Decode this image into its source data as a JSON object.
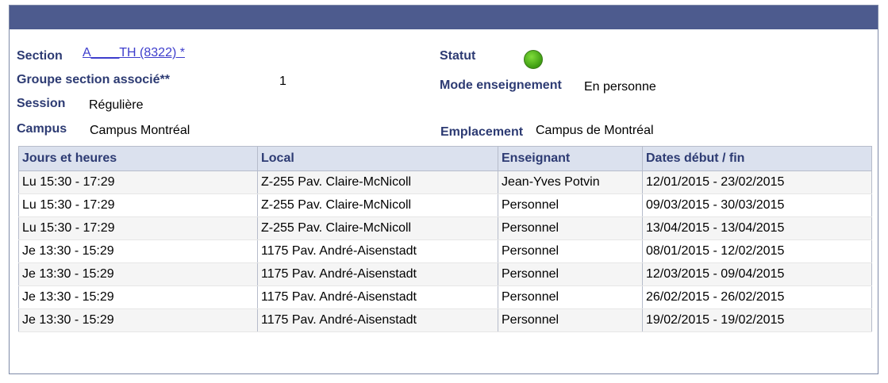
{
  "section": {
    "label": "Section",
    "value": "A____TH (8322) *"
  },
  "statut": {
    "label": "Statut",
    "indicator": "green-circle-icon",
    "color": "#52b81e"
  },
  "groupe": {
    "label": "Groupe section associé**",
    "value": "1"
  },
  "mode": {
    "label": "Mode enseignement",
    "value": "En personne"
  },
  "session": {
    "label": "Session",
    "value": "Régulière"
  },
  "campus": {
    "label": "Campus",
    "value": "Campus Montréal"
  },
  "emplacement": {
    "label": "Emplacement",
    "value": "Campus de Montréal"
  },
  "table": {
    "headers": [
      "Jours et heures",
      "Local",
      "Enseignant",
      "Dates début / fin"
    ],
    "rows": [
      [
        "Lu 15:30 - 17:29",
        "Z-255 Pav. Claire-McNicoll",
        "Jean-Yves Potvin",
        "12/01/2015 - 23/02/2015"
      ],
      [
        "Lu 15:30 - 17:29",
        "Z-255 Pav. Claire-McNicoll",
        "Personnel",
        "09/03/2015 - 30/03/2015"
      ],
      [
        "Lu 15:30 - 17:29",
        "Z-255 Pav. Claire-McNicoll",
        "Personnel",
        "13/04/2015 - 13/04/2015"
      ],
      [
        "Je 13:30 - 15:29",
        "1175 Pav. André-Aisenstadt",
        "Personnel",
        "08/01/2015 - 12/02/2015"
      ],
      [
        "Je 13:30 - 15:29",
        "1175 Pav. André-Aisenstadt",
        "Personnel",
        "12/03/2015 - 09/04/2015"
      ],
      [
        "Je 13:30 - 15:29",
        "1175 Pav. André-Aisenstadt",
        "Personnel",
        "26/02/2015 - 26/02/2015"
      ],
      [
        "Je 13:30 - 15:29",
        "1175 Pav. André-Aisenstadt",
        "Personnel",
        "19/02/2015 - 19/02/2015"
      ]
    ]
  }
}
